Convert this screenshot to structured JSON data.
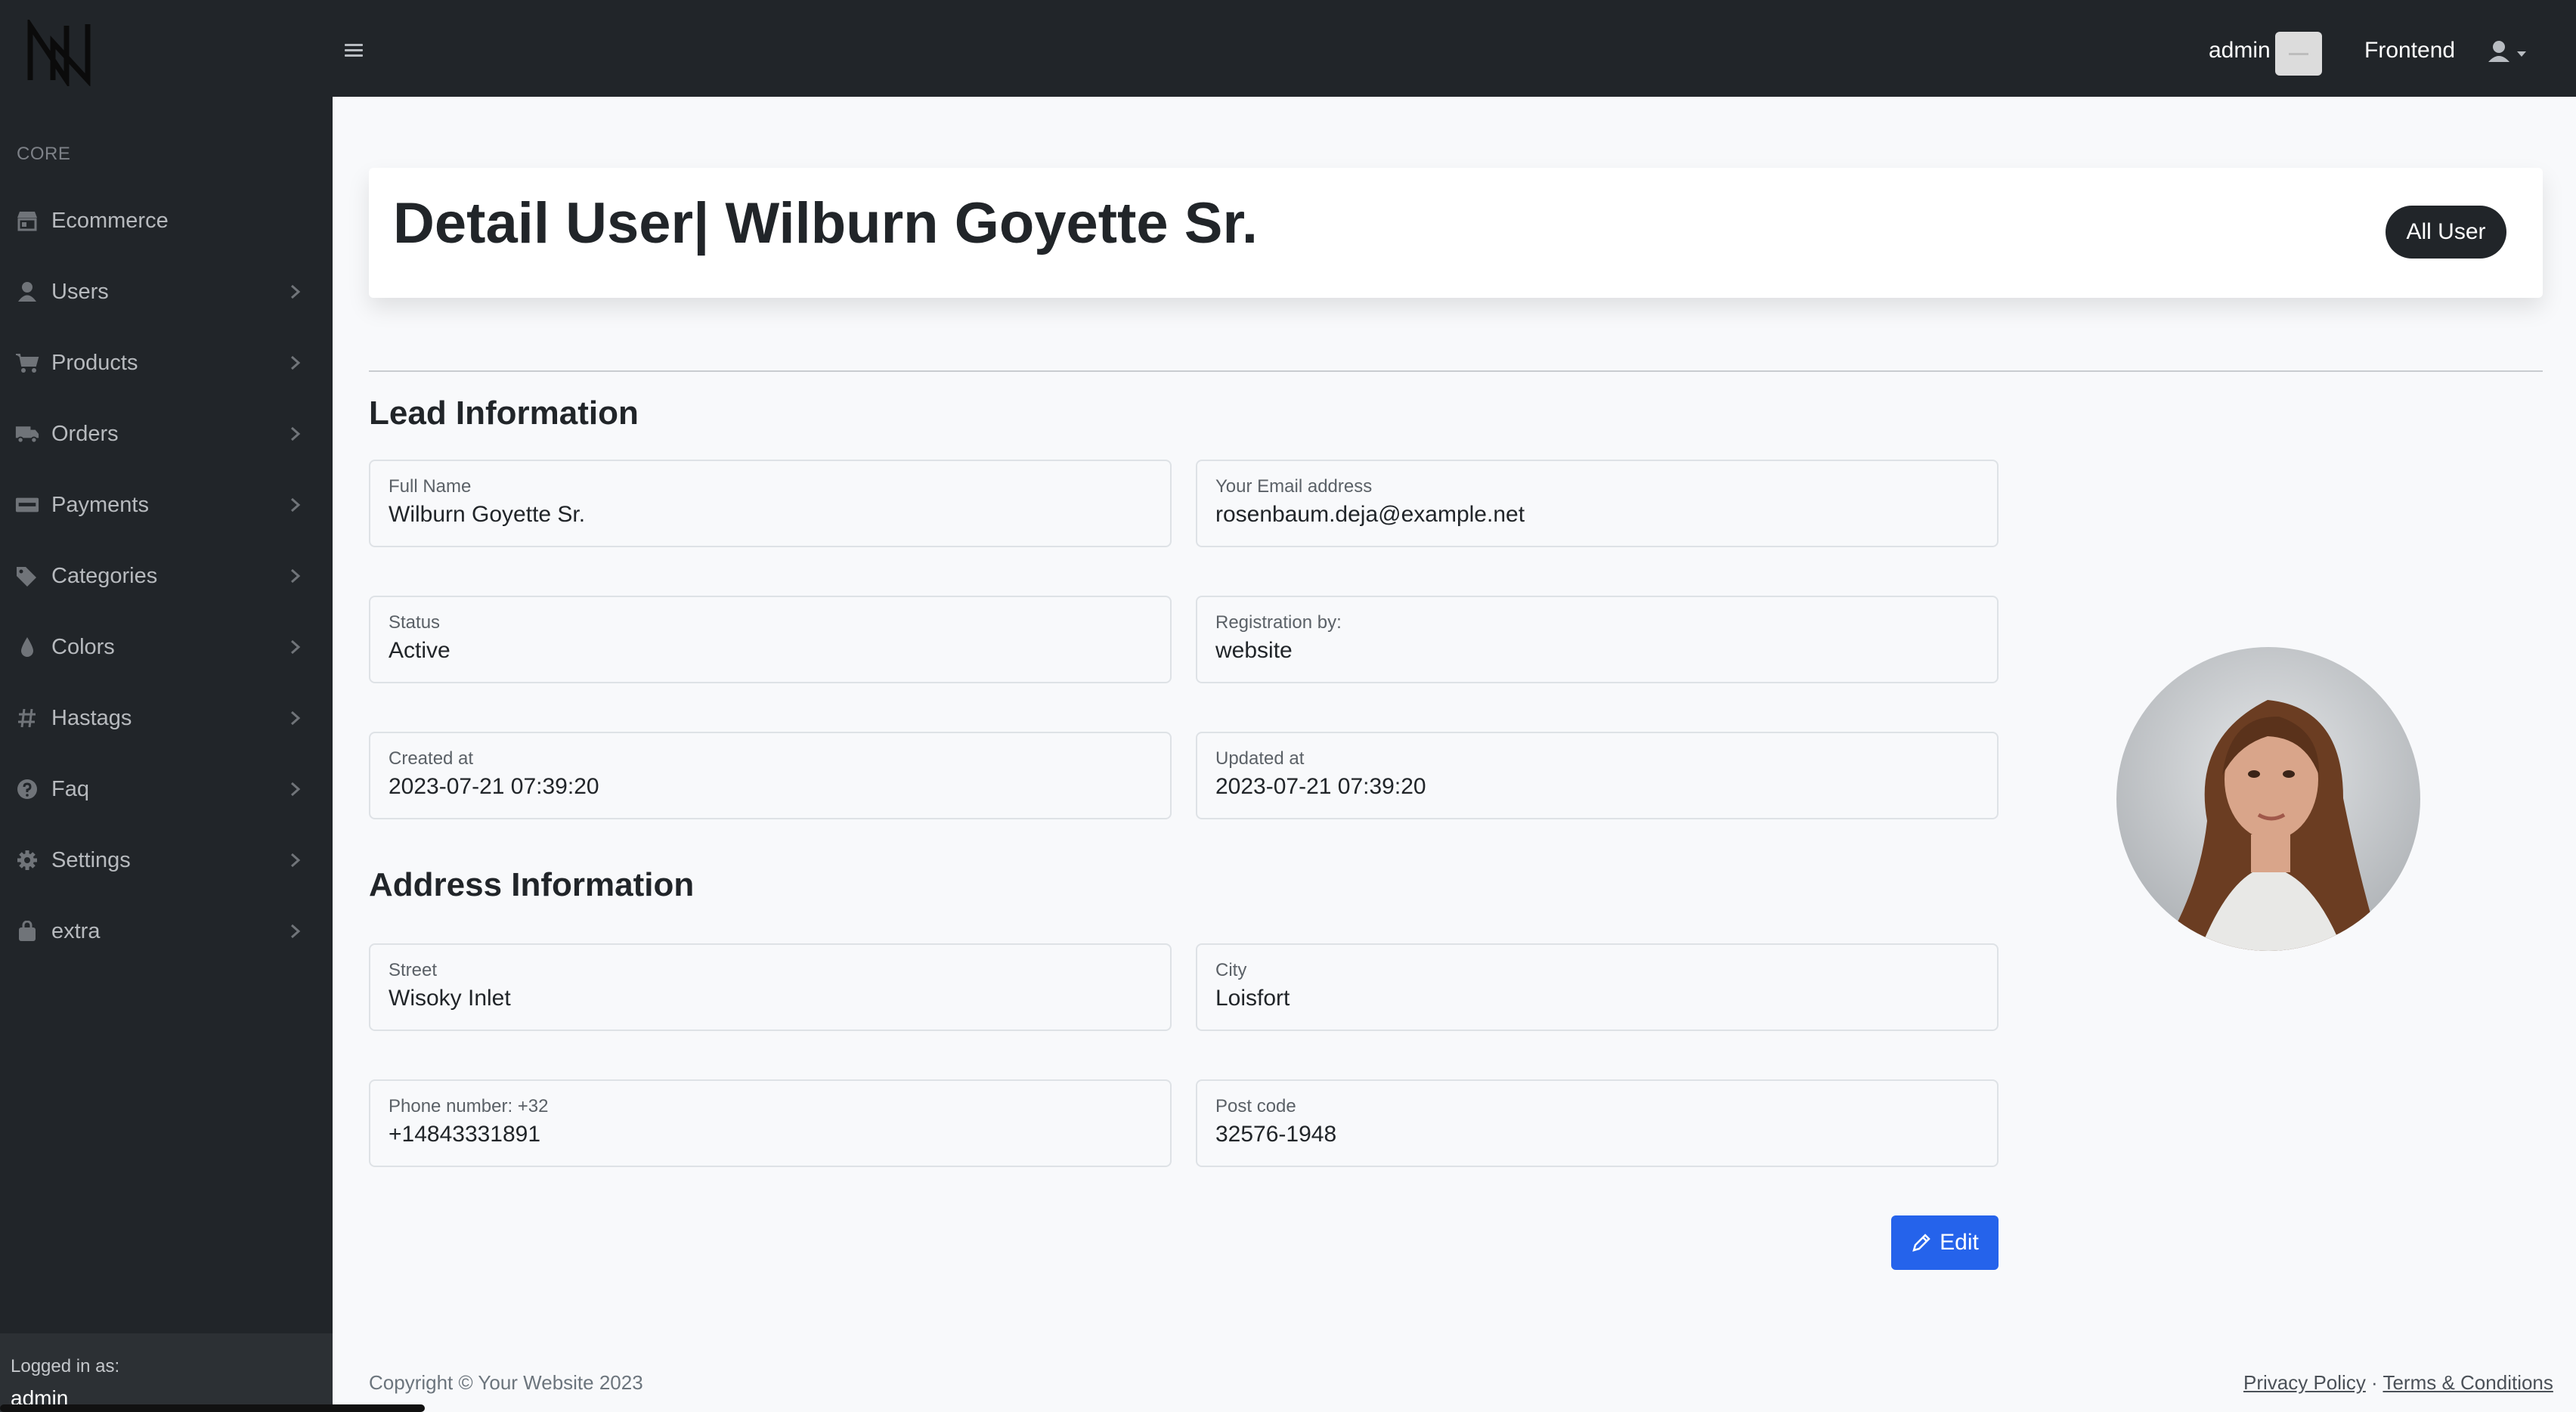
{
  "topbar": {
    "admin_label": "admin",
    "frontend_label": "Frontend"
  },
  "sidebar": {
    "heading": "CORE",
    "items": [
      {
        "label": "Ecommerce",
        "icon": "store-icon",
        "has_chevron": false
      },
      {
        "label": "Users",
        "icon": "user-icon",
        "has_chevron": true
      },
      {
        "label": "Products",
        "icon": "cart-icon",
        "has_chevron": true
      },
      {
        "label": "Orders",
        "icon": "truck-icon",
        "has_chevron": true
      },
      {
        "label": "Payments",
        "icon": "money-icon",
        "has_chevron": true
      },
      {
        "label": "Categories",
        "icon": "tags-icon",
        "has_chevron": true
      },
      {
        "label": "Colors",
        "icon": "droplet-icon",
        "has_chevron": true
      },
      {
        "label": "Hastags",
        "icon": "hashtag-icon",
        "has_chevron": true
      },
      {
        "label": "Faq",
        "icon": "question-circle-icon",
        "has_chevron": true
      },
      {
        "label": "Settings",
        "icon": "gear-icon",
        "has_chevron": true
      },
      {
        "label": "extra",
        "icon": "bag-icon",
        "has_chevron": true
      }
    ],
    "footer": {
      "logged_in_label": "Logged in as:",
      "logged_in_user": "admin"
    }
  },
  "header": {
    "title": "Detail User| Wilburn Goyette Sr.",
    "all_user_button": "All User"
  },
  "lead_section": {
    "title": "Lead Information",
    "fields": {
      "full_name": {
        "label": "Full Name",
        "value": "Wilburn Goyette Sr."
      },
      "email": {
        "label": "Your Email address",
        "value": "rosenbaum.deja@example.net"
      },
      "status": {
        "label": "Status",
        "value": "Active"
      },
      "registration": {
        "label": "Registration by:",
        "value": "website"
      },
      "created_at": {
        "label": "Created at",
        "value": "2023-07-21 07:39:20"
      },
      "updated_at": {
        "label": "Updated at",
        "value": "2023-07-21 07:39:20"
      }
    }
  },
  "address_section": {
    "title": "Address Information",
    "fields": {
      "street": {
        "label": "Street",
        "value": "Wisoky Inlet"
      },
      "city": {
        "label": "City",
        "value": "Loisfort"
      },
      "phone": {
        "label": "Phone number: +32",
        "value": "+14843331891"
      },
      "postcode": {
        "label": "Post code",
        "value": "32576-1948"
      }
    }
  },
  "edit_button": "Edit",
  "footer": {
    "copyright": "Copyright © Your Website 2023",
    "privacy": "Privacy Policy",
    "separator": " · ",
    "terms": "Terms & Conditions"
  },
  "colors": {
    "dark": "#212529",
    "accent": "#2563eb",
    "page_bg": "#f8f9fb"
  }
}
